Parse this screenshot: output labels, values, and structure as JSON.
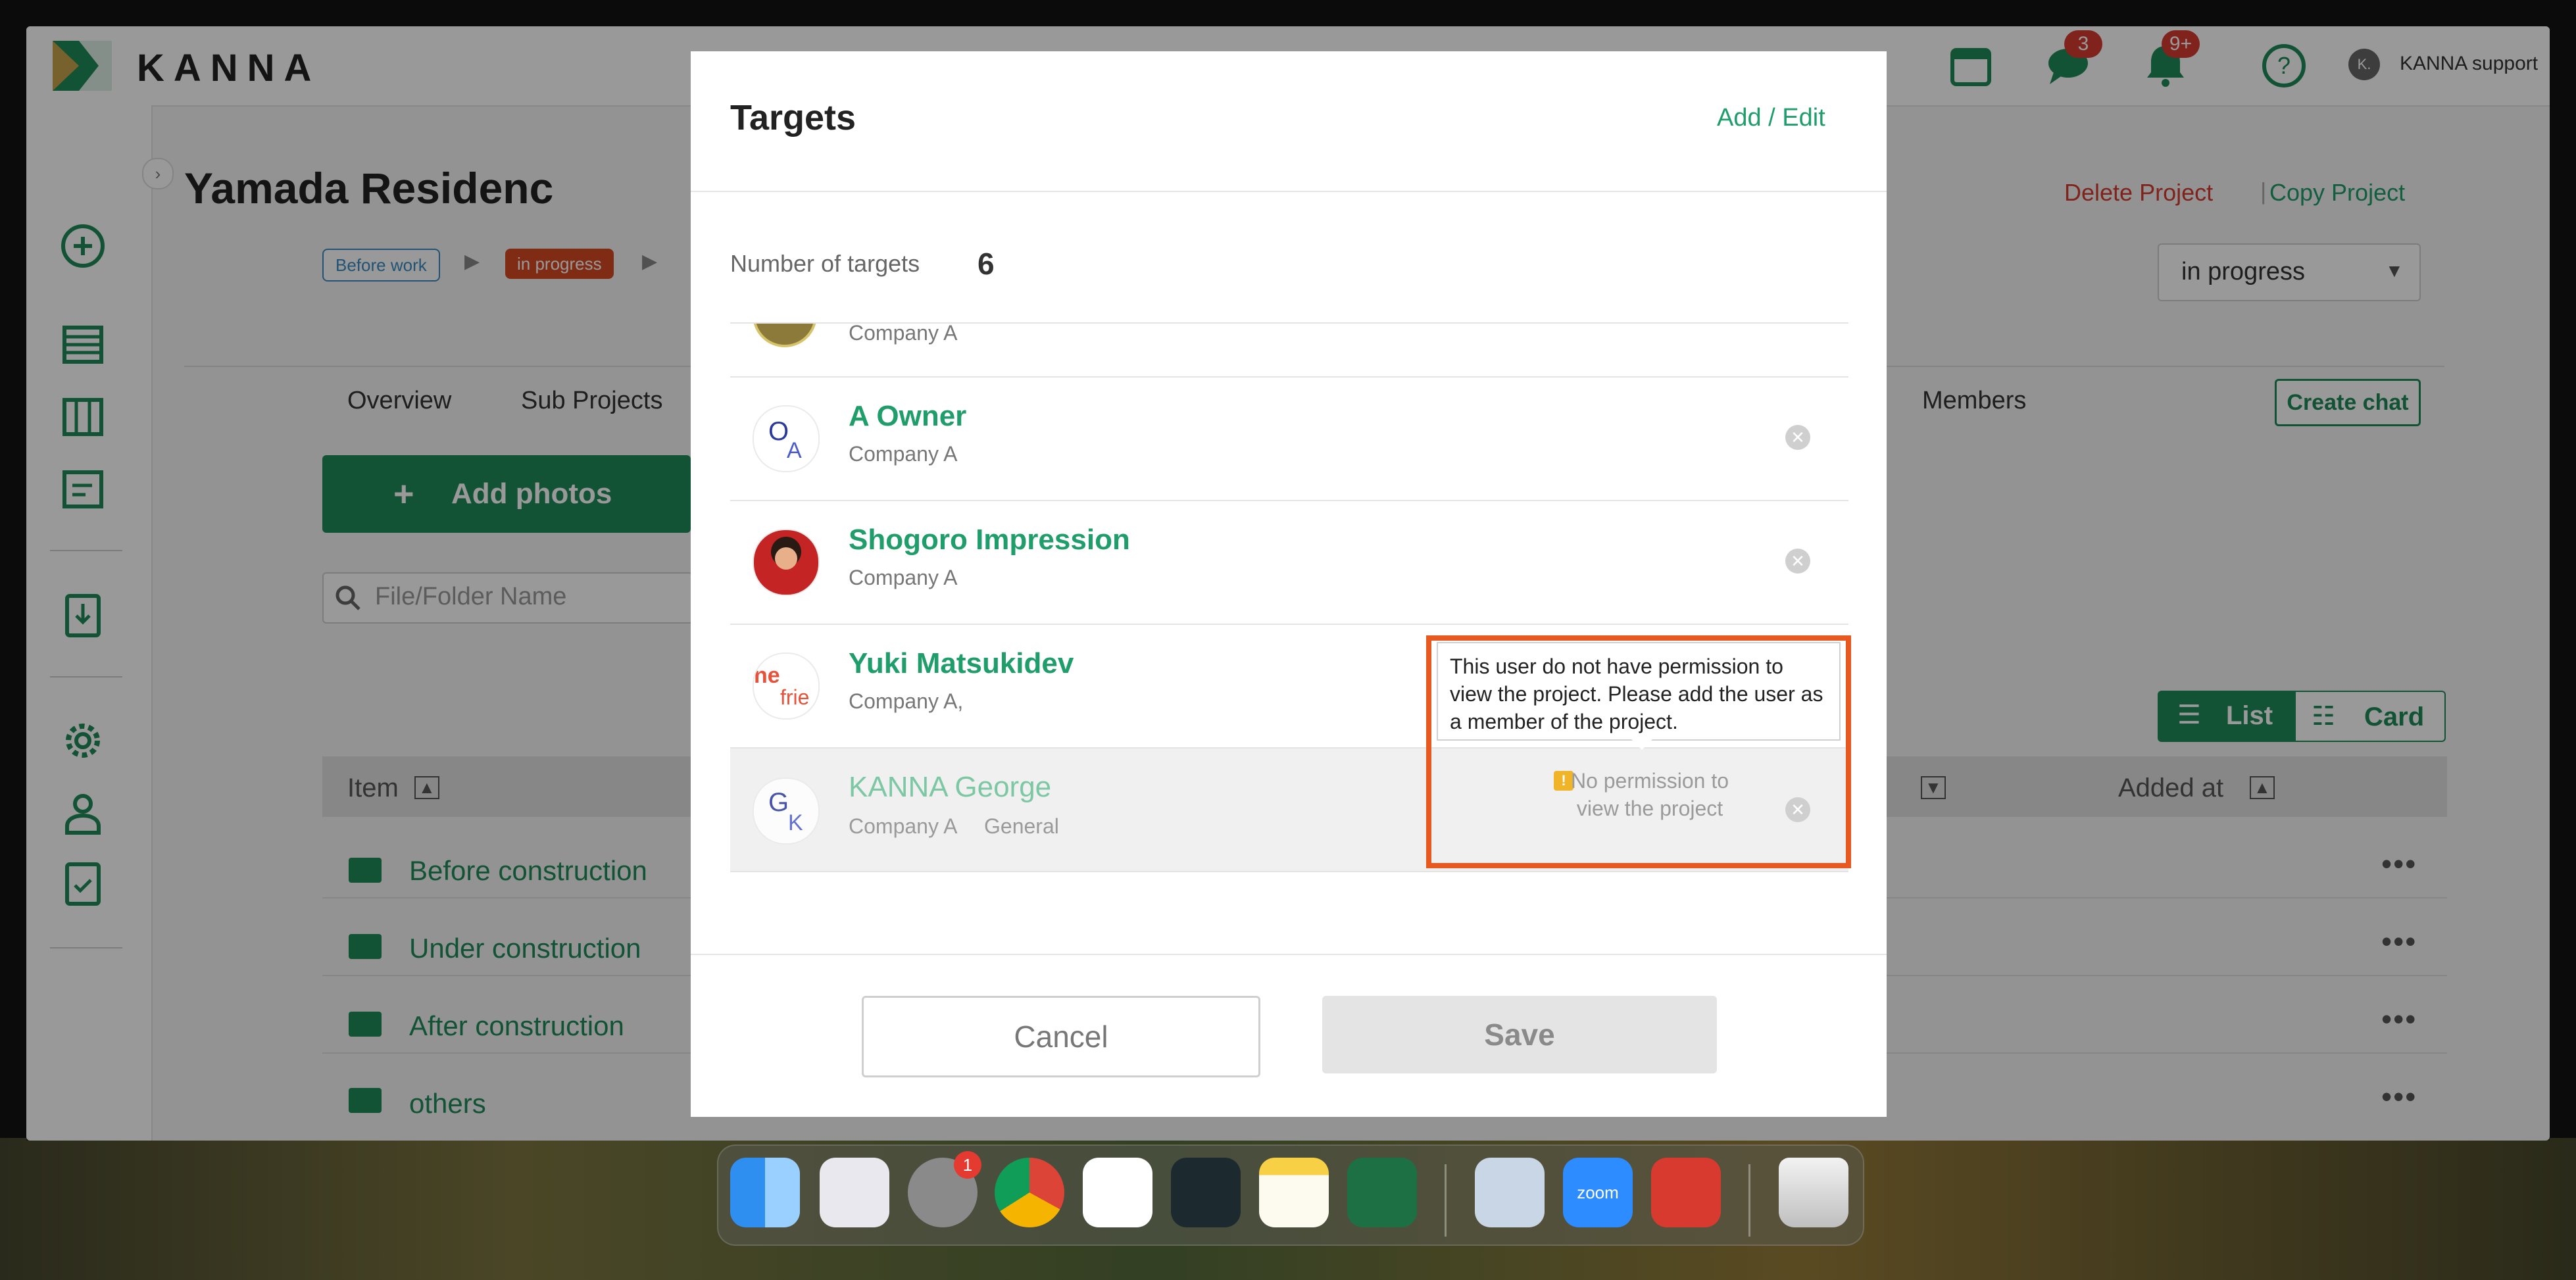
{
  "app": {
    "logo": "KANNA",
    "user": "KANNA support",
    "user_initial": "K.",
    "badges": {
      "chat": "3",
      "notifications": "9+"
    }
  },
  "project": {
    "title": "Yamada Residenc",
    "status_steps": [
      "Before work",
      "in progress"
    ],
    "delete_label": "Delete Project",
    "copy_label": "Copy Project",
    "status_select": "in progress",
    "create_chat": "Create chat"
  },
  "tabs": [
    "Overview",
    "Sub Projects",
    "Members"
  ],
  "photos": {
    "add_label": "Add photos",
    "search_placeholder": "File/Folder Name",
    "view_list": "List",
    "view_card": "Card",
    "col_item": "Item",
    "col_added": "Added at",
    "folders": [
      "Before construction",
      "Under construction",
      "After construction",
      "others"
    ]
  },
  "modal": {
    "title": "Targets",
    "add_edit": "Add / Edit",
    "num_label": "Number of targets",
    "num_value": "6",
    "targets": [
      {
        "name": "",
        "company": "Company A",
        "avatar": "photo"
      },
      {
        "name": "A Owner",
        "company": "Company A",
        "avatar": "OA"
      },
      {
        "name": "Shogoro Impression",
        "company": "Company A",
        "avatar": "photo-red"
      },
      {
        "name": "Yuki Matsukidev",
        "company": "Company A,",
        "avatar": "logo"
      },
      {
        "name": "KANNA George",
        "company": "Company A",
        "role": "General",
        "avatar": "GK"
      }
    ],
    "tooltip": "This user do not have permission to view the project. Please add the user as a member of the project.",
    "no_permission": "No permission to view the project",
    "cancel": "Cancel",
    "save": "Save"
  },
  "dock": [
    "Finder",
    "Launchpad",
    "System Settings",
    "Chrome",
    "Slack",
    "Filmora",
    "Notes",
    "Excel",
    "Preview",
    "Zoom",
    "Photo Booth",
    "Trash"
  ],
  "dock_badge": "1",
  "colors": {
    "brand": "#1f9d6a",
    "danger": "#d63b2f",
    "highlight": "#e8591f"
  }
}
